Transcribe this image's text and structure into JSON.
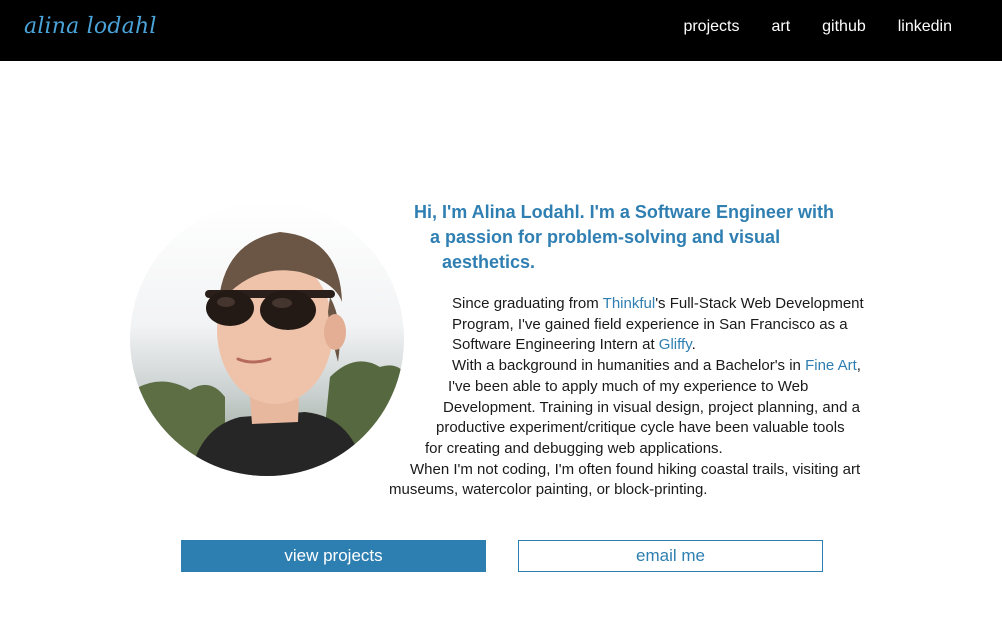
{
  "header": {
    "brand": "alina lodahl",
    "nav": [
      "projects",
      "art",
      "github",
      "linkedin"
    ]
  },
  "avatar": {
    "alt": "Photo of Alina Lodahl"
  },
  "headline": {
    "lines": [
      "Hi, I'm Alina Lodahl. I'm a Software Engineer with",
      "a passion for problem-solving and visual",
      "aesthetics."
    ]
  },
  "bio": {
    "p1_a": "Since graduating from ",
    "p1_link1": "Thinkful",
    "p1_b": "'s Full-Stack Web Development",
    "p1_c": "Program, I've gained field experience in San Francisco as a",
    "p1_d": "Software Engineering Intern at ",
    "p1_link2": "Gliffy",
    "p1_e": ".",
    "p2_a": "With a background in humanities and a Bachelor's in ",
    "p2_link": "Fine Art",
    "p2_b": ",",
    "p2_c": "I've been able to apply much of my experience to Web",
    "p2_d": "Development. Training in visual design, project planning, and a",
    "p2_e": "productive experiment/critique cycle have been valuable tools",
    "p2_f": "for creating and debugging web applications.",
    "p3_a": "When I'm not coding, I'm often found hiking coastal trails, visiting art",
    "p3_b": "museums, watercolor painting, or block-printing."
  },
  "buttons": {
    "primary": "view projects",
    "secondary": "email me"
  },
  "colors": {
    "accent": "#2e7fb1",
    "brand": "#4aa3d8",
    "header_bg": "#000000"
  }
}
